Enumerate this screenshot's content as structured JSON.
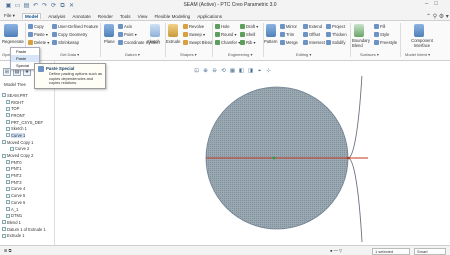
{
  "window": {
    "title": "SEAM (Active) - PTC Creo Parametric 3.0"
  },
  "qat": {
    "icons": [
      "new-icon",
      "open-icon",
      "save-icon",
      "undo-icon",
      "redo-icon",
      "regenerate-icon",
      "windows-icon",
      "close-icon"
    ],
    "symbols": [
      "▣",
      "▭",
      "▤",
      "↶",
      "↷",
      "⟳",
      "⧉",
      "✕"
    ]
  },
  "win_controls": [
    "–",
    "□"
  ],
  "menu": {
    "tabs": [
      "File ▾",
      "Model",
      "Analysis",
      "Annotate",
      "Render",
      "Tools",
      "View",
      "Flexible Modeling",
      "Applications"
    ],
    "active_index": 1,
    "right": "⌃ ⚲ ⚙ ▾"
  },
  "ribbon": {
    "operations": {
      "regenerate": "Regenerate",
      "menu_label": "▾"
    },
    "get_data": {
      "copy": "Copy",
      "paste": "Paste ▾",
      "delete": "Delete ▾",
      "user_defined_feature": "User-Defined Feature",
      "copy_geometry": "Copy Geometry",
      "shrinkwrap": "Shrinkwrap"
    },
    "datum": {
      "axis": "Axis",
      "point": "Point ▾",
      "coord": "Coordinate System",
      "plane": "Plane",
      "sketch": "Sketch"
    },
    "shapes": {
      "extrude": "Extrude",
      "revolve": "Revolve",
      "sweep": "Sweep ▾",
      "swept_blend": "Swept Blend"
    },
    "engineering": {
      "hole": "Hole",
      "draft": "Draft ▾",
      "round": "Round ▾",
      "shell": "Shell",
      "chamfer": "Chamfer ▾",
      "rib": "Rib ▾"
    },
    "editing": {
      "pattern": "Pattern",
      "mirror": "Mirror",
      "extend": "Extend",
      "trim": "Trim",
      "merge": "Merge",
      "intersect": "Intersect",
      "project": "Project",
      "offset": "Offset",
      "thicken": "Thicken",
      "solidify": "Solidify"
    },
    "surfaces": {
      "fill": "Fill",
      "style": "Style",
      "boundary_blend": "Boundary Blend",
      "freestyle": "Freestyle"
    },
    "model_intent": {
      "component_interface": "Component Interface"
    },
    "groups": [
      "Opera",
      "Get Data ▾",
      "Datum ▾",
      "Shapes ▾",
      "Engineering ▾",
      "Editing ▾",
      "Surfaces ▾",
      "Model Intent ▾"
    ]
  },
  "paste_menu": {
    "items": [
      "Paste",
      "Paste Special"
    ],
    "highlight_index": 1
  },
  "tooltip": {
    "title": "Paste Special",
    "description": "Define pasting options such as copies dependencies and copies relations."
  },
  "sidebar": {
    "tabs": [
      "model-tree-icon",
      "folder-icon",
      "favorites-icon"
    ],
    "tab_symbols": [
      "⊞",
      "▤",
      "★"
    ],
    "label": "Model Tree",
    "tree": [
      {
        "t": "SEAM.PRT",
        "ind": 0
      },
      {
        "t": "RIGHT",
        "ind": 1
      },
      {
        "t": "TOP",
        "ind": 1
      },
      {
        "t": "FRONT",
        "ind": 1
      },
      {
        "t": "PRT_CSYS_DEF",
        "ind": 1
      },
      {
        "t": "Sketch 1",
        "ind": 1
      },
      {
        "t": "Curve 1",
        "ind": 1,
        "sel": true
      },
      {
        "t": "Moved Copy 1",
        "ind": 0
      },
      {
        "t": "Curve 2",
        "ind": 2
      },
      {
        "t": "Moved Copy 2",
        "ind": 0
      },
      {
        "t": "PNT0",
        "ind": 1
      },
      {
        "t": "PNT1",
        "ind": 1
      },
      {
        "t": "PNT2",
        "ind": 1
      },
      {
        "t": "PNT3",
        "ind": 1
      },
      {
        "t": "Curve 4",
        "ind": 1
      },
      {
        "t": "Curve 5",
        "ind": 1
      },
      {
        "t": "Curve 6",
        "ind": 1
      },
      {
        "t": "A_1",
        "ind": 1
      },
      {
        "t": "DTM1",
        "ind": 1
      },
      {
        "t": "Blend 1",
        "ind": 0
      },
      {
        "t": "Datum 1 of Extrude 1",
        "ind": 0
      },
      {
        "t": "Extrude 1",
        "ind": 0
      }
    ]
  },
  "graphics_toolbar": {
    "icons": [
      "refit-icon",
      "zoom-in-icon",
      "zoom-out-icon",
      "repaint-icon",
      "view-manager-icon",
      "saved-orientations-icon",
      "display-style-icon",
      "datum-display-icon",
      "annotations-icon"
    ],
    "symbols": [
      "⊡",
      "⊕",
      "⊖",
      "⟲",
      "▦",
      "◧",
      "◨",
      "⌖",
      "⊹"
    ]
  },
  "status": {
    "left": "⊞  ⧉",
    "filter_label": "1 selected",
    "filter_value": "Smart",
    "mid": "● — ▽"
  }
}
